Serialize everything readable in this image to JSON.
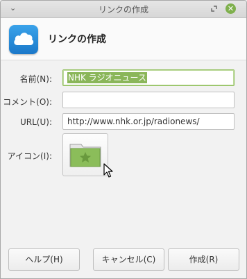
{
  "window": {
    "title": "リンクの作成",
    "menu_glyph": "⌄",
    "close_glyph": "✕"
  },
  "header": {
    "title": "リンクの作成",
    "icon": "cloud-icon"
  },
  "form": {
    "name_label": "名前(N):",
    "name_value": "NHK ラジオニュース",
    "comment_label": "コメント(O):",
    "comment_value": "",
    "url_label": "URL(U):",
    "url_value": "http://www.nhk.or.jp/radionews/",
    "icon_label": "アイコン(I):",
    "icon_name": "folder-star-icon"
  },
  "buttons": {
    "help": "ヘルプ(H)",
    "cancel": "キャンセル(C)",
    "create": "作成(R)"
  },
  "colors": {
    "accent": "#8ab659",
    "app_icon_blue": "#1b78c9",
    "folder_green": "#8bbd5a"
  }
}
